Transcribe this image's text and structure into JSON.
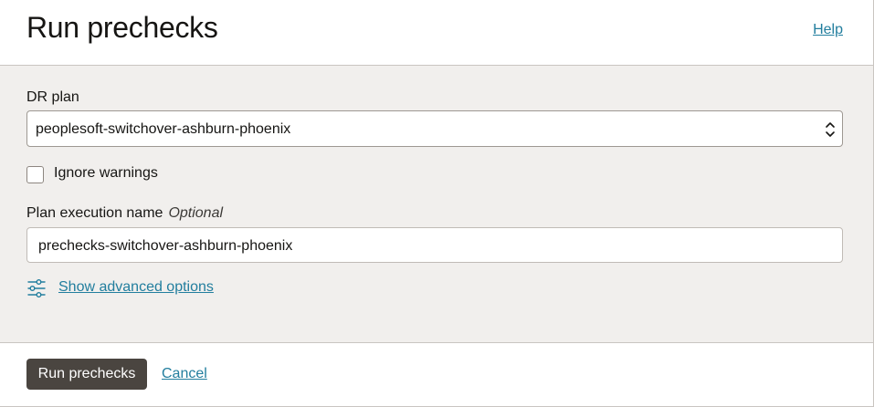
{
  "header": {
    "title": "Run prechecks",
    "help_label": "Help"
  },
  "form": {
    "dr_plan": {
      "label": "DR plan",
      "selected_value": "peoplesoft-switchover-ashburn-phoenix"
    },
    "ignore_warnings": {
      "label": "Ignore warnings",
      "checked": false
    },
    "plan_execution_name": {
      "label": "Plan execution name",
      "optional_label": "Optional",
      "value": "prechecks-switchover-ashburn-phoenix"
    },
    "advanced": {
      "icon": "sliders-icon",
      "label": "Show advanced options"
    }
  },
  "footer": {
    "primary_label": "Run prechecks",
    "cancel_label": "Cancel"
  },
  "colors": {
    "link": "#227e9e",
    "primary_button": "#4a4540",
    "body_background": "#f1efed"
  }
}
